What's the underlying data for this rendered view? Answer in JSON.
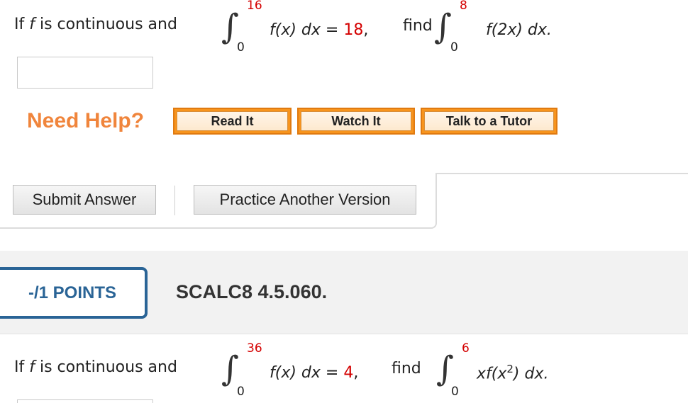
{
  "q1": {
    "prefix": "If ",
    "f": "f",
    "mid": " is continuous and",
    "int1_upper": "16",
    "int1_lower": "0",
    "int1_body": "f(x) dx = ",
    "int1_value": "18",
    "comma": ",",
    "find": "find",
    "int2_upper": "8",
    "int2_lower": "0",
    "int2_body": "f(2x) dx."
  },
  "help": {
    "label": "Need Help?",
    "buttons": [
      "Read It",
      "Watch It",
      "Talk to a Tutor"
    ]
  },
  "actions": {
    "submit": "Submit Answer",
    "practice": "Practice Another Version"
  },
  "q2_header": {
    "points": "-/1 POINTS",
    "id": "SCALC8 4.5.060."
  },
  "q2": {
    "prefix": "If ",
    "f": "f",
    "mid": " is continuous and",
    "int1_upper": "36",
    "int1_lower": "0",
    "int1_body": "f(x) dx = ",
    "int1_value": "4",
    "comma": ",",
    "find": "find",
    "int2_upper": "6",
    "int2_lower": "0",
    "int2_body_pre": "xf(x",
    "int2_body_exp": "2",
    "int2_body_post": ") dx."
  },
  "colors": {
    "accent_red": "#d40000",
    "help_orange": "#f0853c",
    "points_blue": "#2a6496"
  }
}
